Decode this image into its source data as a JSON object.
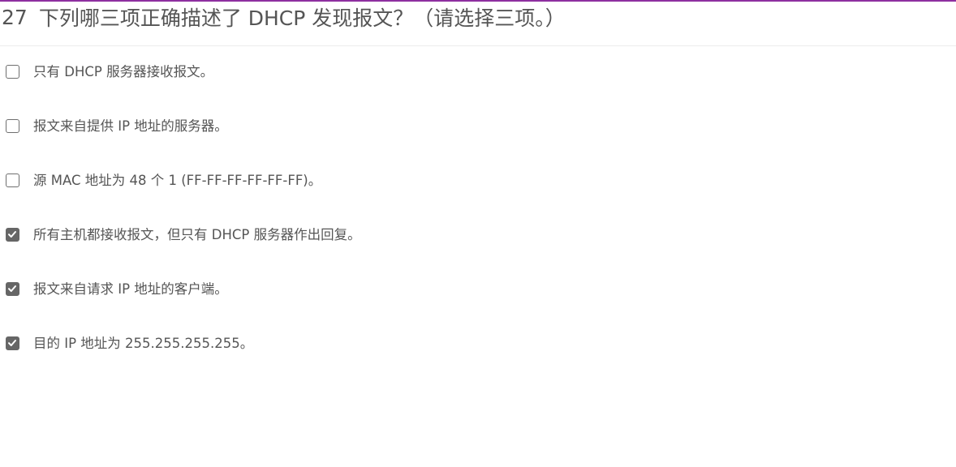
{
  "question": {
    "number": "27",
    "text": "下列哪三项正确描述了 DHCP 发现报文？（请选择三项。）"
  },
  "options": [
    {
      "label": "只有 DHCP 服务器接收报文。",
      "checked": false
    },
    {
      "label": "报文来自提供 IP 地址的服务器。",
      "checked": false
    },
    {
      "label": "源 MAC 地址为 48 个 1 (FF-FF-FF-FF-FF-FF)。",
      "checked": false
    },
    {
      "label": "所有主机都接收报文，但只有 DHCP 服务器作出回复。",
      "checked": true
    },
    {
      "label": "报文来自请求 IP 地址的客户端。",
      "checked": true
    },
    {
      "label": "目的 IP 地址为 255.255.255.255。",
      "checked": true
    }
  ],
  "colors": {
    "accent": "#8e2fa0",
    "text": "#555555",
    "checkbox_checked": "#666666"
  },
  "icons": {
    "checked": "checkmark-icon"
  }
}
